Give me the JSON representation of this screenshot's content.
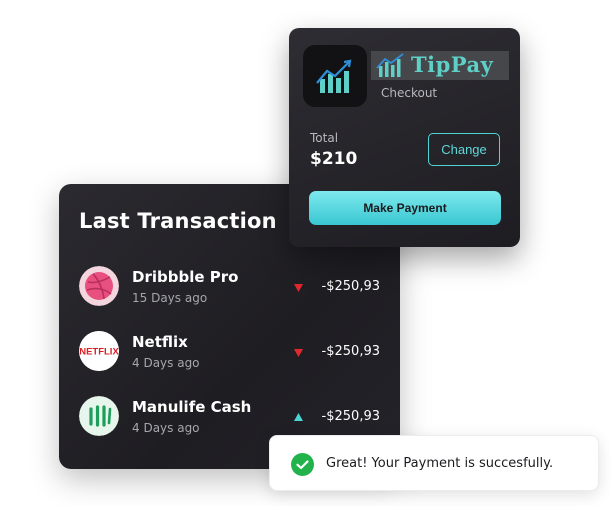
{
  "checkout": {
    "brand": "TipPay",
    "subtitle": "Checkout",
    "total_label": "Total",
    "total_value": "$210",
    "change_label": "Change",
    "pay_label": "Make Payment"
  },
  "transactions": {
    "title": "Last Transaction",
    "items": [
      {
        "name": "Dribbble Pro",
        "when": "15 Days ago",
        "amount": "-$250,93",
        "direction": "down",
        "logo": "dribbble-icon",
        "logo_text": ""
      },
      {
        "name": "Netflix",
        "when": "4 Days ago",
        "amount": "-$250,93",
        "direction": "down",
        "logo": "netflix-icon",
        "logo_text": "NETFLIX"
      },
      {
        "name": "Manulife Cash",
        "when": "4 Days ago",
        "amount": "-$250,93",
        "direction": "up",
        "logo": "manulife-icon",
        "logo_text": ""
      }
    ]
  },
  "toast": {
    "message": "Great! Your Payment is succesfully.",
    "icon": "check-circle-icon"
  },
  "colors": {
    "accent": "#4fd4d4",
    "down": "#e0282f",
    "up": "#4fd4d4",
    "success": "#22b24c"
  }
}
